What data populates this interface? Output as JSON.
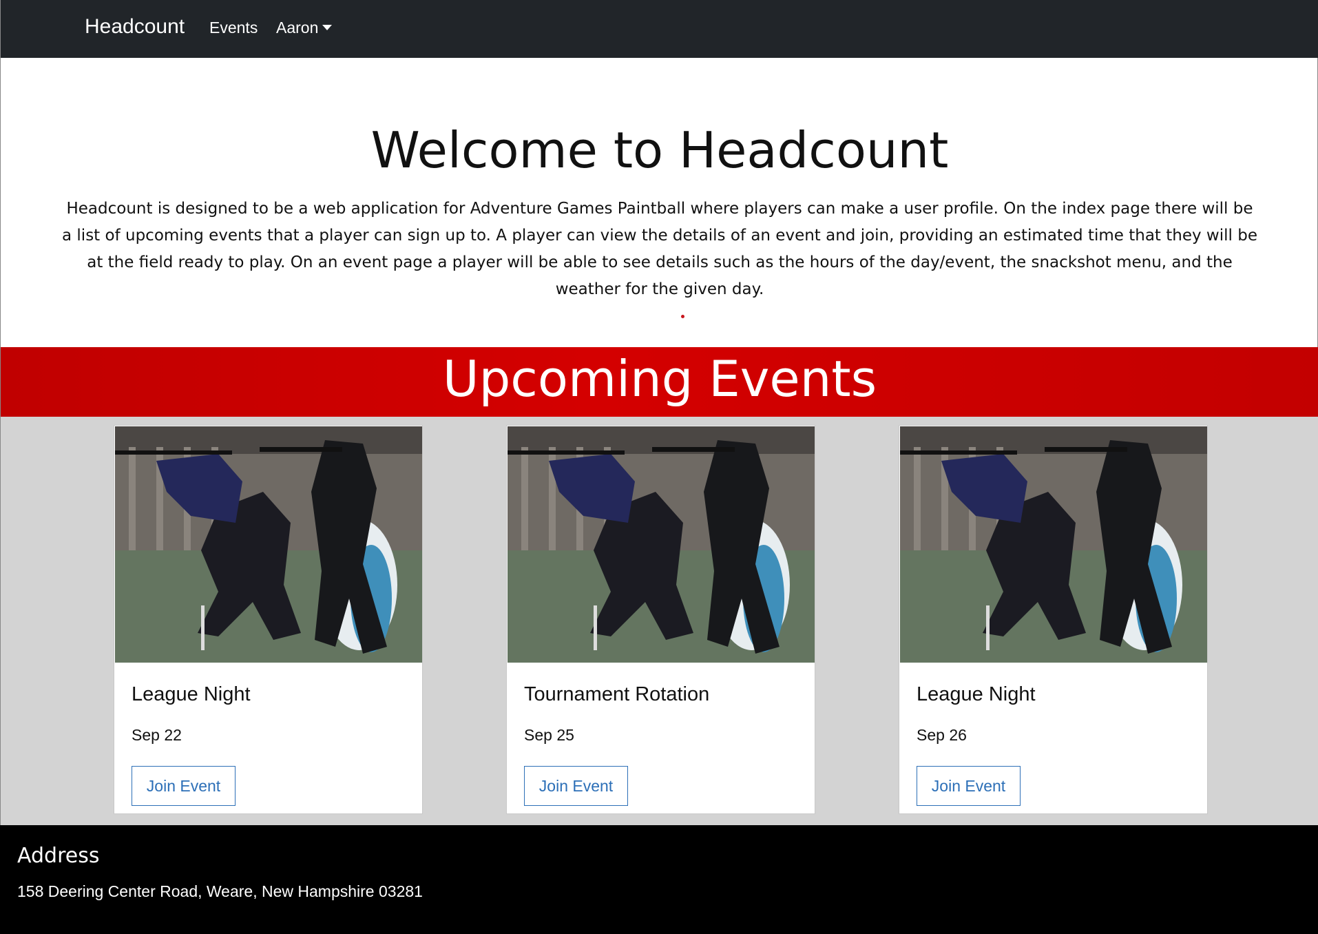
{
  "navbar": {
    "brand": "Headcount",
    "links": [
      {
        "label": "Events"
      },
      {
        "label": "Aaron"
      }
    ]
  },
  "hero": {
    "title": "Welcome to Headcount",
    "description": "Headcount is designed to be a web application for Adventure Games Paintball where players can make a user profile. On the index page there will be a list of upcoming events that a player can sign up to. A player can view the details of an event and join, providing an estimated time that they will be at the field ready to play. On an event page a player will be able to see details such as the hours of the day/event, the snackshot menu, and the weather for the given day."
  },
  "events_section": {
    "title": "Upcoming Events",
    "events": [
      {
        "title": "League Night",
        "date": "Sep 22",
        "button_label": "Join Event"
      },
      {
        "title": "Tournament Rotation",
        "date": "Sep 25",
        "button_label": "Join Event"
      },
      {
        "title": "League Night",
        "date": "Sep 26",
        "button_label": "Join Event"
      }
    ]
  },
  "footer": {
    "heading": "Address",
    "address": "158 Deering Center Road, Weare, New Hampshire 03281"
  },
  "colors": {
    "navbar_bg": "#212529",
    "banner_red": "#cc0000",
    "cards_bg": "#d3d3d3",
    "button_blue": "#2c6fb7",
    "footer_bg": "#000000"
  }
}
